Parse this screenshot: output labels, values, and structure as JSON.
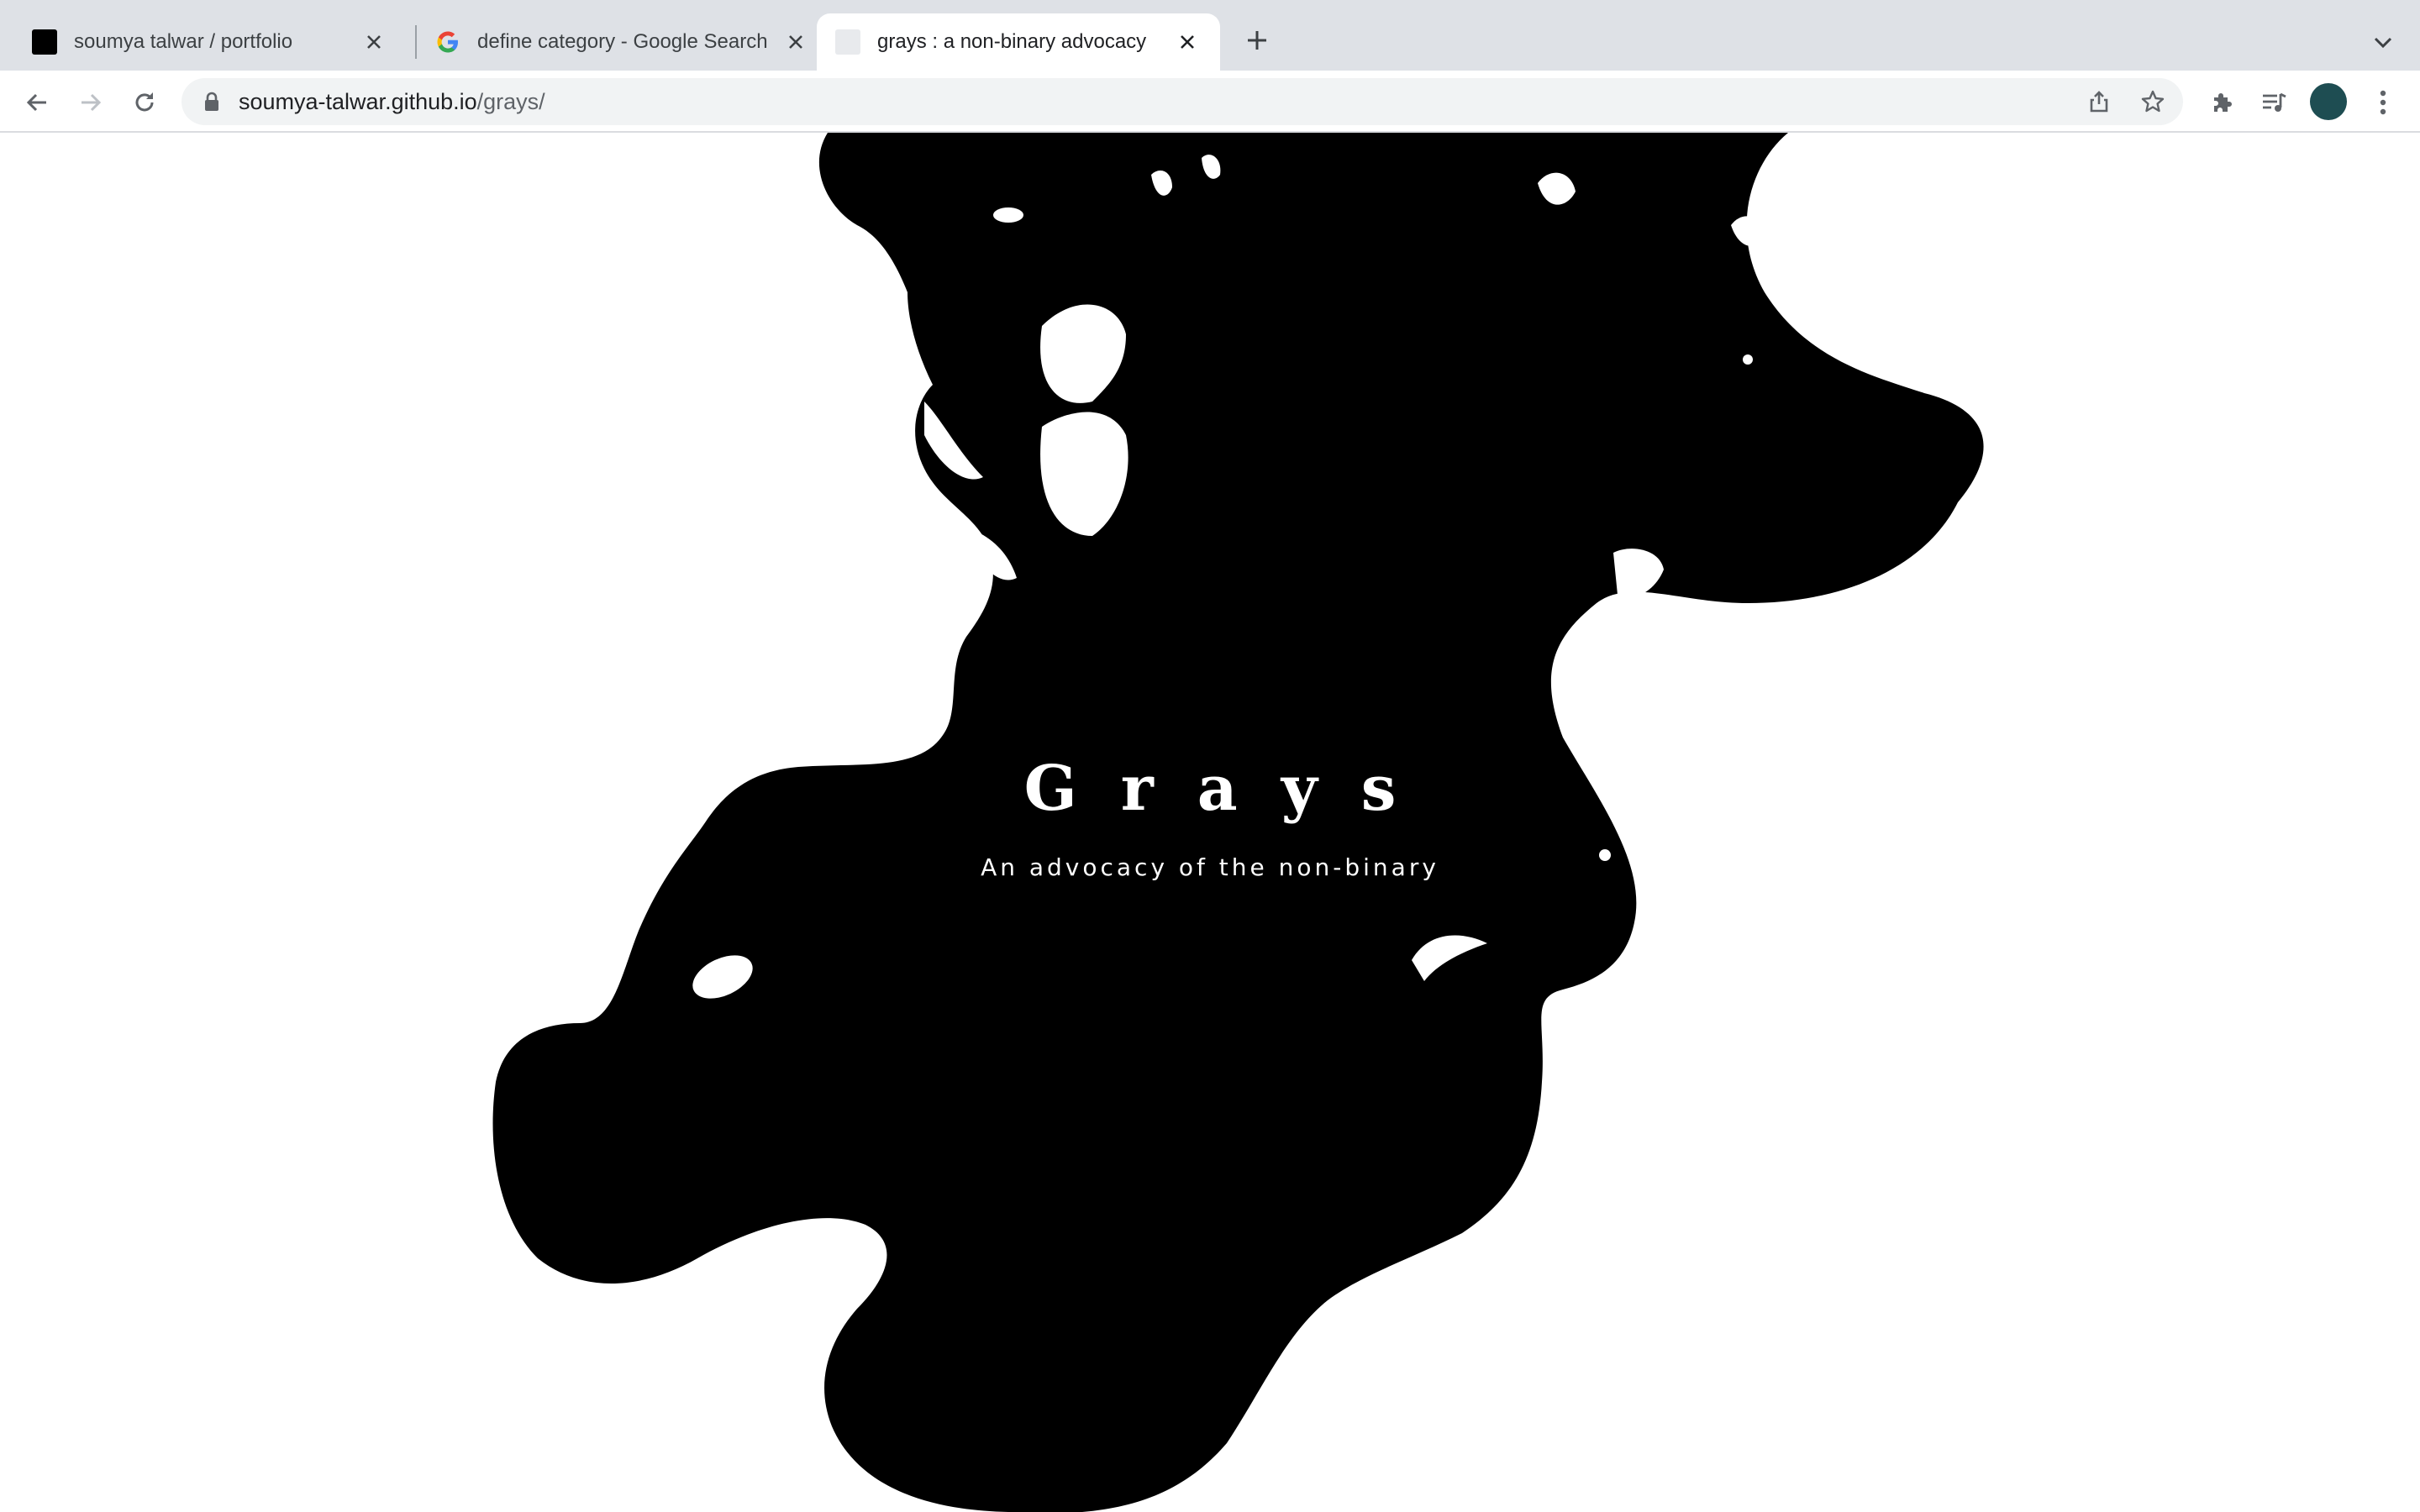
{
  "browser": {
    "tabs": [
      {
        "title": "soumya talwar / portfolio",
        "favicon": "black-square-favicon",
        "active": false
      },
      {
        "title": "define category - Google Search",
        "favicon": "google-g-favicon",
        "active": false
      },
      {
        "title": "grays : a non-binary advocacy",
        "favicon": "blank-favicon",
        "active": true
      }
    ],
    "address_bar": {
      "host": "soumya-talwar.github.io",
      "path": "/grays/"
    },
    "profile_color": "#1e4d52"
  },
  "page": {
    "title": "Grays",
    "subtitle": "An advocacy of the non-binary",
    "ink_color": "#000000",
    "background_color": "#ffffff"
  }
}
